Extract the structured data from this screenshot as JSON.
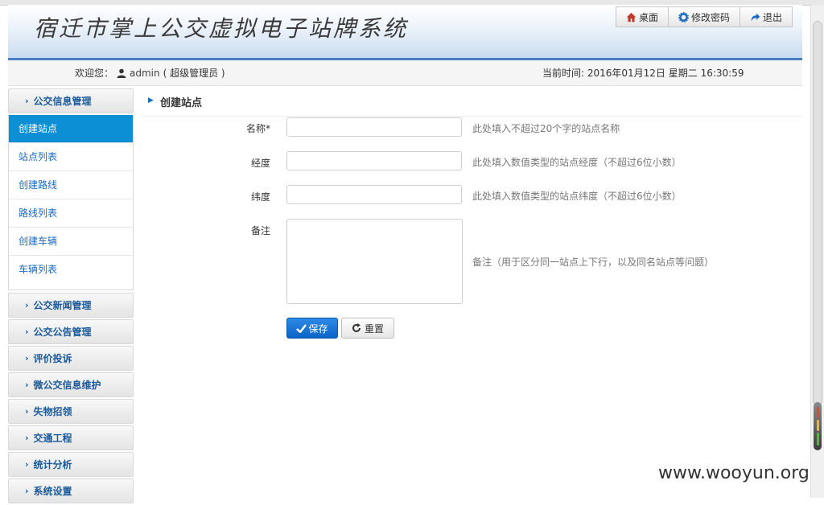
{
  "header": {
    "title": "宿迁市掌上公交虚拟电子站牌系统",
    "buttons": [
      {
        "label": "桌面",
        "icon": "home-icon"
      },
      {
        "label": "修改密码",
        "icon": "gear-icon"
      },
      {
        "label": "退出",
        "icon": "exit-arrow-icon"
      }
    ]
  },
  "infobar": {
    "welcome_label": "欢迎您：",
    "username": "admin",
    "role": "( 超级管理员 )",
    "time_label": "当前时间: 2016年01月12日  星期二 16:30:59"
  },
  "sidebar": {
    "groups": [
      {
        "label": "公交信息管理",
        "expanded": true,
        "items": [
          "创建站点",
          "站点列表",
          "创建路线",
          "路线列表",
          "创建车辆",
          "车辆列表"
        ],
        "active_item": "创建站点"
      },
      {
        "label": "公交新闻管理"
      },
      {
        "label": "公交公告管理"
      },
      {
        "label": "评价投诉"
      },
      {
        "label": "微公交信息维护"
      },
      {
        "label": "失物招领"
      },
      {
        "label": "交通工程"
      },
      {
        "label": "统计分析"
      },
      {
        "label": "系统设置"
      }
    ]
  },
  "main": {
    "section_title": "创建站点",
    "fields": [
      {
        "label": "名称*",
        "value": "",
        "hint": "此处填入不超过20个字的站点名称"
      },
      {
        "label": "经度",
        "value": "",
        "hint": "此处填入数值类型的站点经度（不超过6位小数）"
      },
      {
        "label": "纬度",
        "value": "",
        "hint": "此处填入数值类型的站点纬度（不超过6位小数）"
      },
      {
        "label": "备注",
        "value": "",
        "hint": "备注（用于区分同一站点上下行，以及同名站点等问题）"
      }
    ],
    "save_label": "保存",
    "reset_label": "重置"
  },
  "watermark": "www.wooyun.org",
  "colors": {
    "accent": "#0c8fd5",
    "header_line": "#4a7fbf",
    "link": "#1a6ac0"
  }
}
